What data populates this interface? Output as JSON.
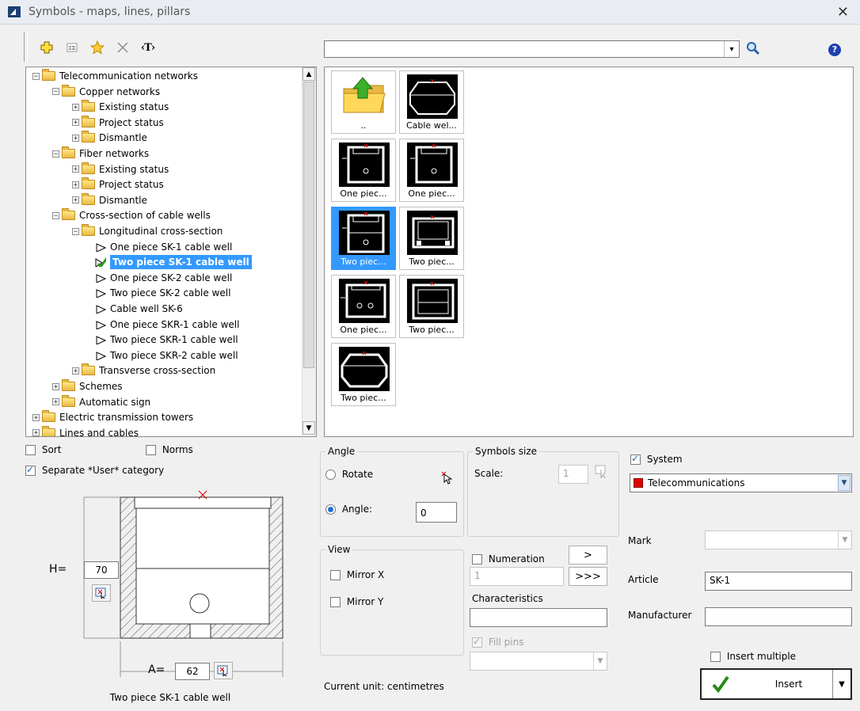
{
  "window": {
    "title": "Symbols - maps, lines, pillars",
    "close": "✕"
  },
  "toolbar": {
    "text_tool_label": "‹T›"
  },
  "search": {
    "value": "",
    "dropdown_arrow": "▾",
    "help": "?"
  },
  "tree": {
    "rows": [
      {
        "level": 0,
        "expander": "−",
        "type": "folder",
        "label": "Telecommunication networks"
      },
      {
        "level": 1,
        "expander": "−",
        "type": "folder",
        "label": "Copper networks"
      },
      {
        "level": 2,
        "expander": "+",
        "type": "folder",
        "label": "Existing status"
      },
      {
        "level": 2,
        "expander": "+",
        "type": "folder",
        "label": "Project status"
      },
      {
        "level": 2,
        "expander": "+",
        "type": "folder",
        "label": "Dismantle"
      },
      {
        "level": 1,
        "expander": "−",
        "type": "folder",
        "label": "Fiber networks"
      },
      {
        "level": 2,
        "expander": "+",
        "type": "folder",
        "label": "Existing status"
      },
      {
        "level": 2,
        "expander": "+",
        "type": "folder",
        "label": "Project status"
      },
      {
        "level": 2,
        "expander": "+",
        "type": "folder",
        "label": "Dismantle"
      },
      {
        "level": 1,
        "expander": "−",
        "type": "folder",
        "label": "Cross-section of cable wells"
      },
      {
        "level": 2,
        "expander": "−",
        "type": "folder",
        "label": "Longitudinal cross-section"
      },
      {
        "level": 3,
        "expander": "",
        "type": "leaf",
        "label": "One piece SK-1 cable well"
      },
      {
        "level": 3,
        "expander": "",
        "type": "checked",
        "label": "Two piece SK-1 cable well",
        "selected": true
      },
      {
        "level": 3,
        "expander": "",
        "type": "leaf",
        "label": "One piece SK-2 cable well"
      },
      {
        "level": 3,
        "expander": "",
        "type": "leaf",
        "label": "Two piece SK-2 cable well"
      },
      {
        "level": 3,
        "expander": "",
        "type": "leaf",
        "label": "Cable well SK-6"
      },
      {
        "level": 3,
        "expander": "",
        "type": "leaf",
        "label": "One piece SKR-1 cable well"
      },
      {
        "level": 3,
        "expander": "",
        "type": "leaf",
        "label": "Two piece SKR-1 cable well"
      },
      {
        "level": 3,
        "expander": "",
        "type": "leaf",
        "label": "Two piece SKR-2 cable well"
      },
      {
        "level": 2,
        "expander": "+",
        "type": "folder",
        "label": "Transverse cross-section"
      },
      {
        "level": 1,
        "expander": "+",
        "type": "folder",
        "label": "Schemes"
      },
      {
        "level": 1,
        "expander": "+",
        "type": "folder",
        "label": "Automatic sign"
      },
      {
        "level": 0,
        "expander": "+",
        "type": "folder",
        "label": "Electric transmission towers"
      },
      {
        "level": 0,
        "expander": "+",
        "type": "folder",
        "label": "Lines and cables"
      }
    ]
  },
  "thumbnails": [
    {
      "caption": "..",
      "kind": "up"
    },
    {
      "caption": "Cable wel...",
      "kind": "octagon"
    },
    {
      "caption": "One piec...",
      "kind": "well"
    },
    {
      "caption": "One piec...",
      "kind": "well"
    },
    {
      "caption": "Two piec...",
      "kind": "well2",
      "selected": true
    },
    {
      "caption": "Two piec...",
      "kind": "rect"
    },
    {
      "caption": "One piec...",
      "kind": "well3"
    },
    {
      "caption": "Two piec...",
      "kind": "rect2"
    },
    {
      "caption": "Two piec...",
      "kind": "octagon2"
    }
  ],
  "options": {
    "sort_label": "Sort",
    "sort_checked": false,
    "norms_label": "Norms",
    "norms_checked": false,
    "separate_label": "Separate *User* category",
    "separate_checked": true
  },
  "preview": {
    "h_label": "H=",
    "h_value": "70",
    "a_label": "A=",
    "a_value": "62",
    "caption": "Two piece SK-1 cable well"
  },
  "angle": {
    "title": "Angle",
    "rotate_label": "Rotate",
    "angle_label": "Angle:",
    "angle_value": "0",
    "mode": "angle"
  },
  "symbols_size": {
    "title": "Symbols size",
    "scale_label": "Scale:",
    "scale_value": "1"
  },
  "view": {
    "title": "View",
    "mirror_x": "Mirror X",
    "mirror_y": "Mirror Y"
  },
  "numeration": {
    "label": "Numeration",
    "checked": false,
    "value": "1",
    "btn_next": ">",
    "btn_all": ">>>"
  },
  "characteristics": {
    "label": "Characteristics",
    "value": ""
  },
  "fill_pins": {
    "label": "Fill pins",
    "checked": true,
    "value": ""
  },
  "system": {
    "label": "System",
    "checked": true,
    "value": "Telecommunications",
    "color": "#e00000"
  },
  "fields": {
    "mark_label": "Mark",
    "mark_value": "",
    "article_label": "Article",
    "article_value": "SK-1",
    "manufacturer_label": "Manufacturer",
    "manufacturer_value": ""
  },
  "insert": {
    "multiple_label": "Insert multiple",
    "multiple_checked": false,
    "button_label": "Insert"
  },
  "status": {
    "current_unit": "Current unit: centimetres"
  },
  "colors": {
    "accent": "#3399ff",
    "selection": "#3399ff",
    "cross": "#e00000"
  }
}
